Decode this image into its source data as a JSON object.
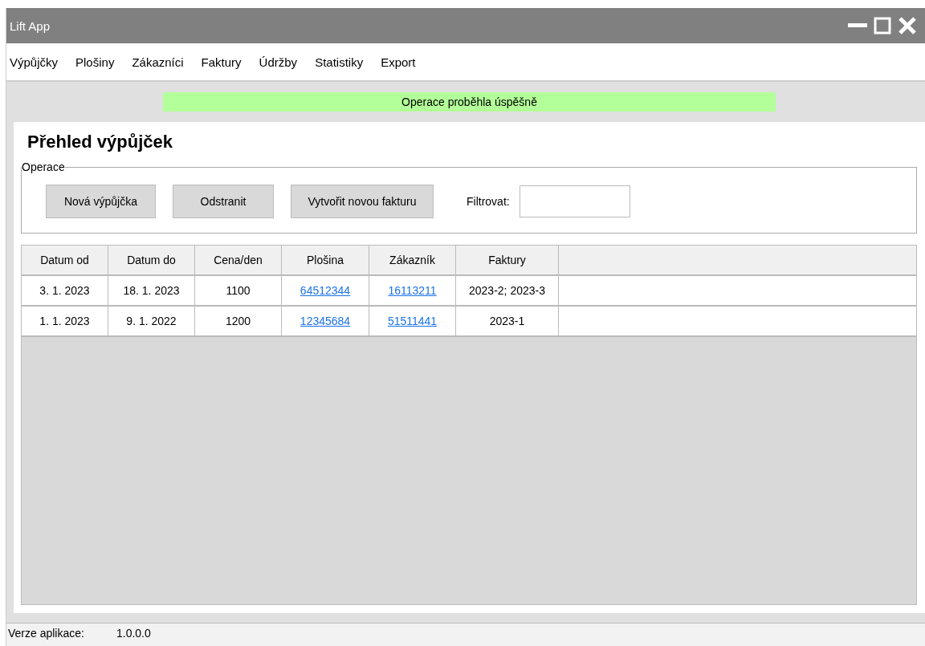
{
  "window": {
    "title": "Lift App"
  },
  "menu": [
    {
      "label": "Výpůjčky"
    },
    {
      "label": "Plošiny"
    },
    {
      "label": "Zákazníci"
    },
    {
      "label": "Faktury"
    },
    {
      "label": "Údržby"
    },
    {
      "label": "Statistiky"
    },
    {
      "label": "Export"
    }
  ],
  "notification": {
    "text": "Operace proběhla úspěšně",
    "color": "#b3ff99"
  },
  "heading": "Přehled výpůjček",
  "operations": {
    "legend": "Operace",
    "buttons": [
      "Nová výpůjčka",
      "Odstranit",
      "Vytvořit novou fakturu"
    ],
    "filter_label": "Filtrovat:"
  },
  "table": {
    "columns": [
      "Datum od",
      "Datum do",
      "Cena/den",
      "Plošina",
      "Zákazník",
      "Faktury"
    ],
    "rows": [
      [
        {
          "text": "3. 1. 2023",
          "kind": "text"
        },
        {
          "text": "18. 1. 2023",
          "kind": "text"
        },
        {
          "text": "1100",
          "kind": "text"
        },
        {
          "text": "64512344",
          "kind": "link"
        },
        {
          "text": "16113211",
          "kind": "link"
        },
        {
          "text": "2023-2; 2023-3",
          "kind": "text"
        }
      ],
      [
        {
          "text": "1. 1. 2023",
          "kind": "text"
        },
        {
          "text": "9. 1. 2022",
          "kind": "text"
        },
        {
          "text": "1200",
          "kind": "text"
        },
        {
          "text": "12345684",
          "kind": "link"
        },
        {
          "text": "51511441",
          "kind": "link"
        },
        {
          "text": "2023-1",
          "kind": "text"
        }
      ]
    ]
  },
  "status_bar": {
    "label": "Verze aplikace:",
    "value": "1.0.0.0"
  }
}
